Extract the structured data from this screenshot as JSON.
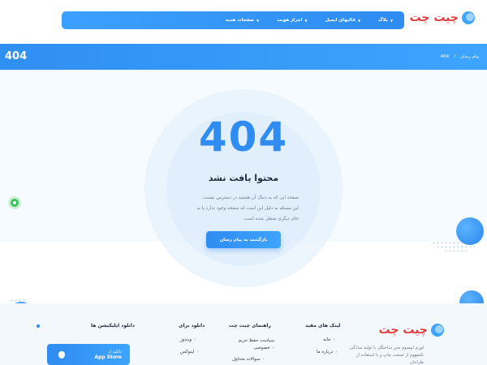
{
  "header": {
    "logo_text": "چیت چت",
    "nav": [
      {
        "label": "بلاگ"
      },
      {
        "label": "قالبهای ایمیل"
      },
      {
        "label": "احراز هویت"
      },
      {
        "label": "صفحات هدیه"
      }
    ]
  },
  "breadcrumb": {
    "big_code": "404",
    "items": [
      "پیام رسان",
      "/",
      "404"
    ]
  },
  "main": {
    "code": "404",
    "title": "محتوا یافت نشد",
    "description": "صفحه ایی که به دنبال آن هستید در دسترس نیست، این مسئله به دلیل این است که صفحه وجود ندارد یا به جای دیگری منتقل شده است.",
    "back_button": "بازگشت به پیام رسان"
  },
  "footer": {
    "logo_text": "چیت چت",
    "about": "لورم ایپسوم متن ساختگی با تولید سادگی نامفهوم از صنعت چاپ و با استفاده از طراحان",
    "useful_links": {
      "title": "لینک های مفید",
      "items": [
        "خانه",
        "درباره ما"
      ]
    },
    "guide": {
      "title": "راهنمای چیت چت",
      "items": [
        "سیاست حفظ حریم خصوصی",
        "سوالات متداول"
      ]
    },
    "download_for": {
      "title": "دانلود برای",
      "items": [
        "ویندوز",
        "لینوکس"
      ]
    },
    "apps": {
      "title": "دانلود اپلیکیشن ها",
      "app_store_line1": "دانلود از",
      "app_store_line2": "App Store"
    }
  },
  "colors": {
    "primary": "#2f8cf0",
    "accent_red": "#e23a3a",
    "green": "#38c25a",
    "background": "#f6fbff"
  }
}
